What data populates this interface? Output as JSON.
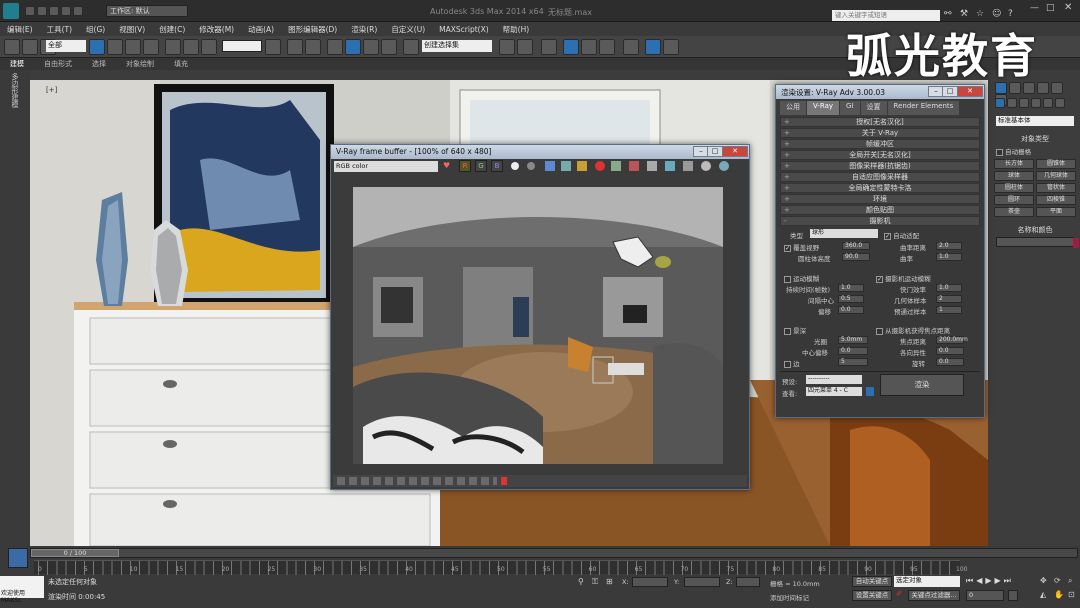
{
  "app": {
    "title": "Autodesk 3ds Max 2014 x64",
    "doc": "无标题.max",
    "workspace": "工作区: 默认",
    "search_placeholder": "键入关键字或短语"
  },
  "menu": [
    "编辑(E)",
    "工具(T)",
    "组(G)",
    "视图(V)",
    "创建(C)",
    "修改器(M)",
    "动画(A)",
    "图形编辑器(D)",
    "渲染(R)",
    "自定义(U)",
    "MAXScript(X)",
    "帮助(H)"
  ],
  "toolbar": {
    "filter": "全部",
    "selection_set": "创建选择集"
  },
  "ribbon": {
    "tabs": [
      "建模",
      "自由形式",
      "选择",
      "对象绘制",
      "填充"
    ],
    "sub": "多边形建模"
  },
  "watermark": "弧光教育",
  "vfb": {
    "title": "V-Ray frame buffer - [100% of 640 x 480]",
    "channel": "RGB color",
    "btn_r": "R",
    "btn_g": "G",
    "btn_b": "B"
  },
  "render_setup": {
    "title": "渲染设置: V-Ray Adv 3.00.03",
    "tabs": [
      "公用",
      "V-Ray",
      "GI",
      "设置",
      "Render Elements"
    ],
    "rollouts": [
      "授权[无名汉化]",
      "关于 V-Ray",
      "帧缓冲区",
      "全局开关[无名汉化]",
      "图像采样器(抗锯齿)",
      "自适应图像采样器",
      "全局确定性蒙特卡洛",
      "环境",
      "颜色贴图",
      "摄影机"
    ],
    "camera": {
      "type_label": "类型",
      "type_value": "球形",
      "override_fov": "覆盖视野",
      "fov_value": "360.0",
      "cyl_height": "圆柱体高度",
      "cyl_height_value": "90.0",
      "auto_fit": "自动适配",
      "dist": "曲率距离",
      "dist_value": "2.0",
      "curve": "曲率",
      "curve_value": "1.0",
      "motion_blur": "运动模糊",
      "duration": "持续时间(帧数)",
      "duration_value": "1.0",
      "center": "间隔中心",
      "center_value": "0.5",
      "bias": "偏移",
      "bias_value": "0.0",
      "camera_mb": "摄影机运动模糊",
      "shutter_eff": "快门效率",
      "shutter_eff_value": "1.0",
      "geo_samples": "几何体样本",
      "geo_samples_value": "2",
      "prepass": "预通过样本",
      "prepass_value": "1",
      "dof": "景深",
      "aperture": "光圈",
      "aperture_value": "5.0mm",
      "center_bias": "中心偏移",
      "center_bias_value": "0.0",
      "side": "边",
      "side_value": "5",
      "from_camera": "从摄影机获得焦点距离",
      "focus_dist": "焦点距离",
      "focus_dist_value": "200.0mm",
      "aniso": "各向异性",
      "aniso_value": "0.0",
      "rotation": "旋转",
      "rotation_value": "0.0"
    },
    "preset_label": "预设:",
    "preset_value": "----------",
    "view_label": "查看:",
    "view_value": "四元菜单 4 - C",
    "render_btn": "渲染"
  },
  "cmd": {
    "dropdown": "标准基本体",
    "group1": "对象类型",
    "autogrid": "自动栅格",
    "items": [
      "长方体",
      "圆锥体",
      "球体",
      "几何球体",
      "圆柱体",
      "管状体",
      "圆环",
      "四棱锥",
      "茶壶",
      "平面"
    ],
    "group2": "名称和颜色"
  },
  "status": {
    "frame": "0 / 100",
    "msg1": "未选定任何对象",
    "msg2": "渲染时间 0:00:45",
    "maxscript": "欢迎使用 MAXSc",
    "x": "X:",
    "y": "Y:",
    "z": "Z:",
    "grid": "栅格 = 10.0mm",
    "autokey": "自动关键点",
    "select_obj": "选定对象",
    "setkey": "设置关键点",
    "keyfilter": "关键点过滤器...",
    "addtag": "添加时间标记",
    "frame_input": "0"
  },
  "timeline_ticks": [
    "0",
    "5",
    "10",
    "15",
    "20",
    "25",
    "30",
    "35",
    "40",
    "45",
    "50",
    "55",
    "60",
    "65",
    "70",
    "75",
    "80",
    "85",
    "90",
    "95",
    "100"
  ],
  "colors": {
    "vray_blue": "#2e6fb2",
    "menu_bg": "#3a3a3a",
    "floor": "#a6692f"
  }
}
